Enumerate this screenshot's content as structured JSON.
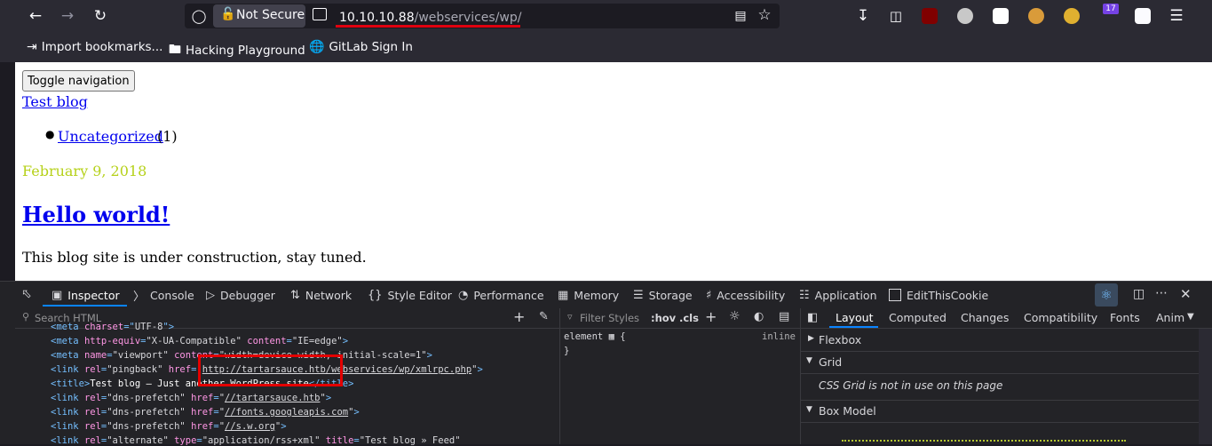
{
  "browser": {
    "security_label": "Not Secure",
    "url_host": "10.10.10.88",
    "url_path": "/webservices/wp/",
    "extension_badge": "17",
    "bookmarks": [
      {
        "label": "Import bookmarks...",
        "icon": "import-icon"
      },
      {
        "label": "Hacking Playground",
        "icon": "folder-icon"
      },
      {
        "label": "GitLab Sign In",
        "icon": "globe-icon"
      }
    ]
  },
  "page": {
    "toggle_nav": "Toggle navigation",
    "site_title": "Test blog",
    "category_link": "Uncategorized",
    "category_count": "(1)",
    "post_date": "February 9, 2018",
    "post_title": "Hello world!",
    "post_body": "This blog site is under construction, stay tuned."
  },
  "devtools": {
    "tabs": [
      "Inspector",
      "Console",
      "Debugger",
      "Network",
      "Style Editor",
      "Performance",
      "Memory",
      "Storage",
      "Accessibility",
      "Application",
      "EditThisCookie"
    ],
    "search_placeholder": "Search HTML",
    "filter_placeholder": "Filter Styles",
    "hov": ":hov",
    "cls": ".cls",
    "rule_selector": "element",
    "rule_open": "{",
    "rule_close": "}",
    "rule_source": "inline",
    "layout_tabs": [
      "Layout",
      "Computed",
      "Changes",
      "Compatibility",
      "Fonts",
      "Anim"
    ],
    "sections": {
      "flexbox": "Flexbox",
      "grid": "Grid",
      "grid_note": "CSS Grid is not in use on this page",
      "box_model": "Box Model"
    },
    "code": {
      "l0_tag": "<meta ",
      "l0_attr": "charset",
      "l0_eq": "=\"",
      "l0_val": "UTF-8",
      "l0_end": "\">",
      "l1_tag": "<meta ",
      "l1_a1": "http-equiv",
      "l1_v1": "\"X-UA-Compatible\"",
      "l1_a2": " content",
      "l1_v2": "\"IE=edge\"",
      "l1_end": ">",
      "l2_tag": "<meta ",
      "l2_a1": "name",
      "l2_v1": "\"viewport\"",
      "l2_a2": " content",
      "l2_v2": "\"width=device-width, initial-scale=1\"",
      "l2_end": ">",
      "l3_tag": "<link ",
      "l3_a1": "rel",
      "l3_v1": "\"pingback\"",
      "l3_a2": " href",
      "l3_v2": "http://tartarsauce.htb/webservices/wp/xmlrpc.php",
      "l3_end": ">",
      "l4_tag": "<title>",
      "l4_text": "Test blog – Just another WordPress site",
      "l4_end": "</title>",
      "l5_tag": "<link ",
      "l5_a1": "rel",
      "l5_v1": "\"dns-prefetch\"",
      "l5_a2": " href",
      "l5_v2": "//tartarsauce.htb",
      "l5_end": ">",
      "l6_tag": "<link ",
      "l6_a1": "rel",
      "l6_v1": "\"dns-prefetch\"",
      "l6_a2": " href",
      "l6_v2": "//fonts.googleapis.com",
      "l6_end": ">",
      "l7_tag": "<link ",
      "l7_a1": "rel",
      "l7_v1": "\"dns-prefetch\"",
      "l7_a2": " href",
      "l7_v2": "//s.w.org",
      "l7_end": ">",
      "l8_tag": "<link ",
      "l8_a1": "rel",
      "l8_v1": "\"alternate\"",
      "l8_a2": " type",
      "l8_v2": "\"application/rss+xml\"",
      "l8_a3": " title",
      "l8_v3": "\"Test blog » Feed\""
    }
  },
  "colors": {
    "highlight_red": "#e30000",
    "accent_blue": "#0a84ff",
    "date_green": "#b6d11a"
  }
}
